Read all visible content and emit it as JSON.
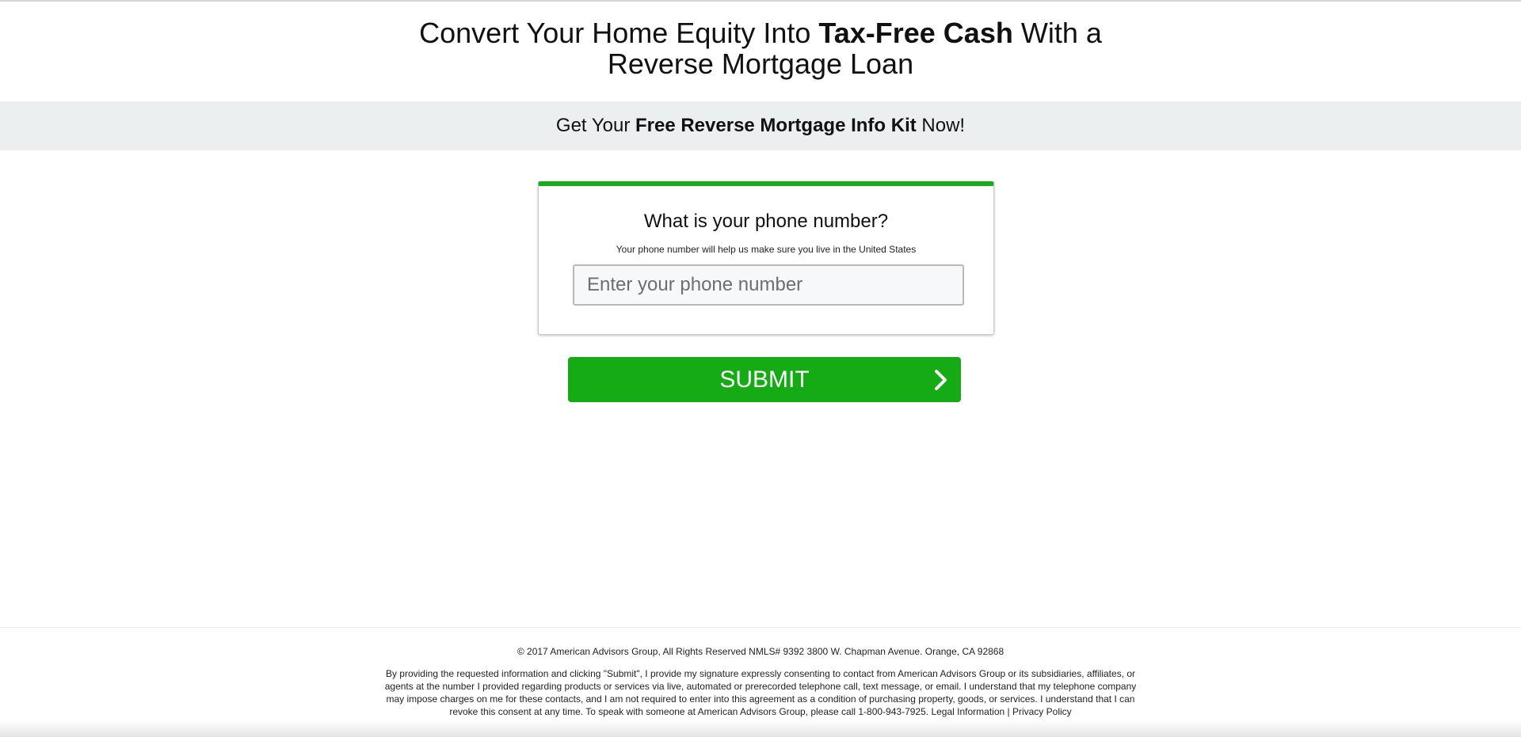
{
  "header": {
    "headline_part1": "Convert Your Home Equity Into ",
    "headline_bold": "Tax-Free Cash",
    "headline_part2": " With a",
    "headline_line2": "Reverse Mortgage Loan"
  },
  "banner": {
    "prefix": "Get Your ",
    "bold": "Free Reverse Mortgage Info Kit",
    "suffix": " Now!"
  },
  "form": {
    "title": "What is your phone number?",
    "subtitle": "Your phone number will help us make sure you live in the United States",
    "phone_placeholder": "Enter your phone number",
    "phone_value": "",
    "submit_label": "SUBMIT",
    "accent_color": "#1aab1a"
  },
  "footer": {
    "copyright": "© 2017 American Advisors Group, All Rights Reserved NMLS# 9392 3800 W. Chapman Avenue. Orange, CA 92868",
    "disclaimer": "By providing the requested information and clicking \"Submit\", I provide my signature expressly consenting to contact from American Advisors Group or its subsidiaries, affiliates, or agents at the number I provided regarding products or services via live, automated or prerecorded telephone call, text message, or email. I understand that my telephone company may impose charges on me for these contacts, and I am not required to enter into this agreement as a condition of purchasing property, goods, or services. I understand that I can revoke this consent at any time. To speak with someone at American Advisors Group, please call 1-800-943-7925. ",
    "legal_link": "Legal Information",
    "separator": " | ",
    "privacy_link": "Privacy Policy"
  }
}
